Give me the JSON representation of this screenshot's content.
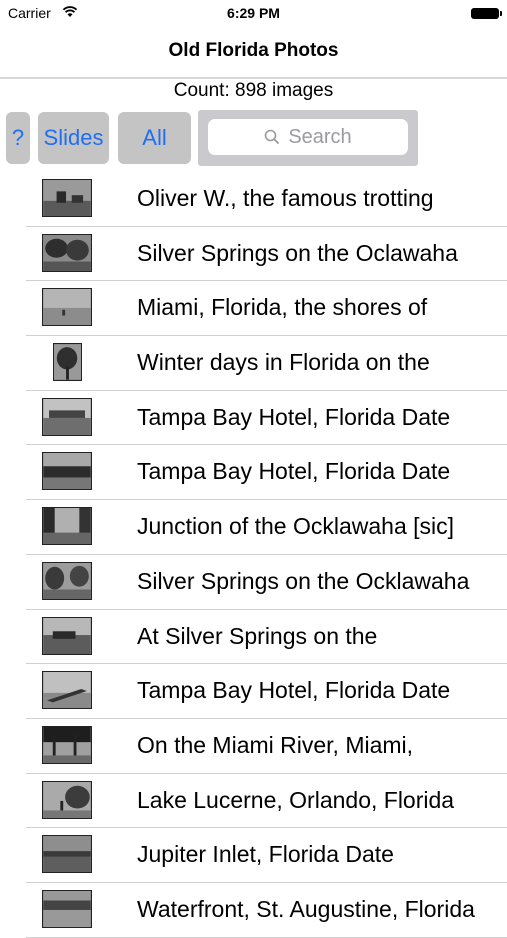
{
  "status": {
    "carrier": "Carrier",
    "time": "6:29 PM"
  },
  "nav": {
    "title": "Old Florida Photos"
  },
  "count_text": "Count: 898 images",
  "toolbar": {
    "help_label": "?",
    "slides_label": "Slides",
    "all_label": "All",
    "search_placeholder": "Search"
  },
  "colors": {
    "accent": "#1f6ef5",
    "button_bg": "#c4c4c4",
    "separator": "#d0d0d0"
  },
  "rows": [
    {
      "title": "Oliver W., the famous trotting"
    },
    {
      "title": "Silver Springs on the Oclawaha"
    },
    {
      "title": "Miami, Florida, the shores of"
    },
    {
      "title": "Winter days in Florida on the"
    },
    {
      "title": "Tampa Bay Hotel, Florida Date"
    },
    {
      "title": "Tampa Bay Hotel, Florida Date"
    },
    {
      "title": "Junction of the Ocklawaha [sic]"
    },
    {
      "title": "Silver Springs on the Ocklawaha"
    },
    {
      "title": "At Silver Springs on the"
    },
    {
      "title": "Tampa Bay Hotel, Florida Date"
    },
    {
      "title": "On the Miami River, Miami,"
    },
    {
      "title": "Lake Lucerne, Orlando, Florida"
    },
    {
      "title": "Jupiter Inlet, Florida Date"
    },
    {
      "title": "Waterfront, St. Augustine, Florida"
    }
  ]
}
